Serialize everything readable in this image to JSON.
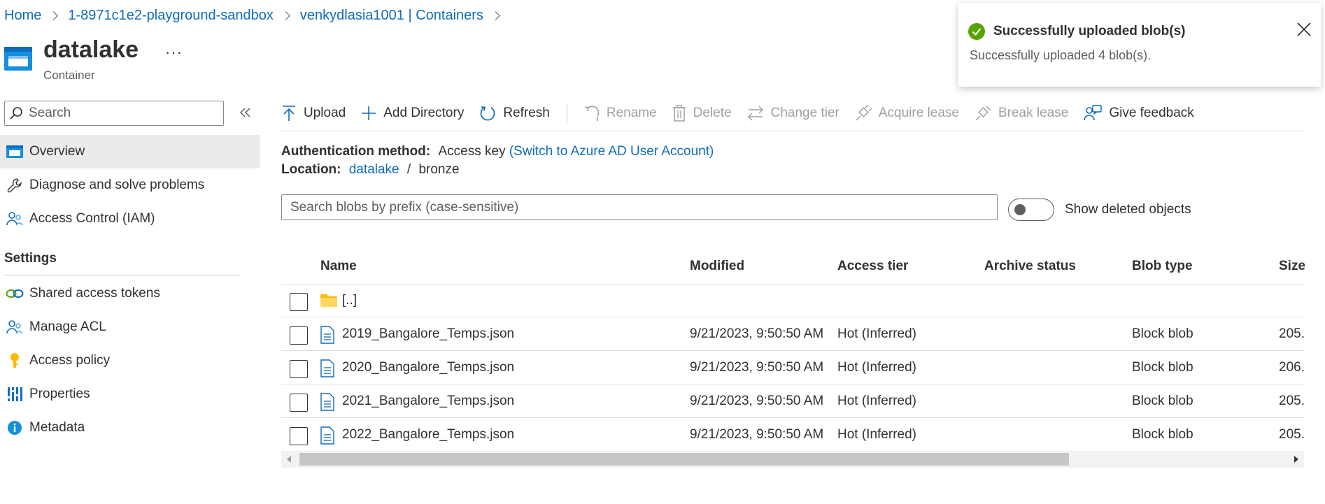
{
  "breadcrumb": [
    {
      "label": "Home"
    },
    {
      "label": "1-8971c1e2-playground-sandbox"
    },
    {
      "label": "venkydlasia1001 | Containers"
    }
  ],
  "header": {
    "title": "datalake",
    "subtitle": "Container",
    "more": "···"
  },
  "sidebar": {
    "search_placeholder": "Search",
    "items": [
      {
        "label": "Overview",
        "icon": "container-icon",
        "active": true
      },
      {
        "label": "Diagnose and solve problems",
        "icon": "wrench-icon"
      },
      {
        "label": "Access Control (IAM)",
        "icon": "people-icon"
      }
    ],
    "section": "Settings",
    "settings_items": [
      {
        "label": "Shared access tokens",
        "icon": "link-icon"
      },
      {
        "label": "Manage ACL",
        "icon": "people-icon"
      },
      {
        "label": "Access policy",
        "icon": "key-icon"
      },
      {
        "label": "Properties",
        "icon": "properties-icon"
      },
      {
        "label": "Metadata",
        "icon": "info-icon"
      }
    ]
  },
  "toolbar": {
    "upload": "Upload",
    "add_directory": "Add Directory",
    "refresh": "Refresh",
    "rename": "Rename",
    "delete": "Delete",
    "change_tier": "Change tier",
    "acquire_lease": "Acquire lease",
    "break_lease": "Break lease",
    "give_feedback": "Give feedback"
  },
  "auth": {
    "label": "Authentication method:",
    "value": "Access key",
    "switch_link": "(Switch to Azure AD User Account)"
  },
  "location": {
    "label": "Location:",
    "root": "datalake",
    "sep": "/",
    "folder": "bronze"
  },
  "filter": {
    "placeholder": "Search blobs by prefix (case-sensitive)",
    "toggle_label": "Show deleted objects",
    "toggle_on": false
  },
  "table": {
    "columns": [
      "Name",
      "Modified",
      "Access tier",
      "Archive status",
      "Blob type",
      "Size"
    ],
    "parent_row": "[..]",
    "rows": [
      {
        "name": "2019_Bangalore_Temps.json",
        "modified": "9/21/2023, 9:50:50 AM",
        "tier": "Hot (Inferred)",
        "archive": "",
        "type": "Block blob",
        "size": "205."
      },
      {
        "name": "2020_Bangalore_Temps.json",
        "modified": "9/21/2023, 9:50:50 AM",
        "tier": "Hot (Inferred)",
        "archive": "",
        "type": "Block blob",
        "size": "206."
      },
      {
        "name": "2021_Bangalore_Temps.json",
        "modified": "9/21/2023, 9:50:50 AM",
        "tier": "Hot (Inferred)",
        "archive": "",
        "type": "Block blob",
        "size": "205."
      },
      {
        "name": "2022_Bangalore_Temps.json",
        "modified": "9/21/2023, 9:50:50 AM",
        "tier": "Hot (Inferred)",
        "archive": "",
        "type": "Block blob",
        "size": "205."
      }
    ]
  },
  "toast": {
    "title": "Successfully uploaded blob(s)",
    "message": "Successfully uploaded 4 blob(s)."
  },
  "colors": {
    "accent": "#0f6cbd",
    "success": "#57a300",
    "folder": "#ffb900"
  }
}
